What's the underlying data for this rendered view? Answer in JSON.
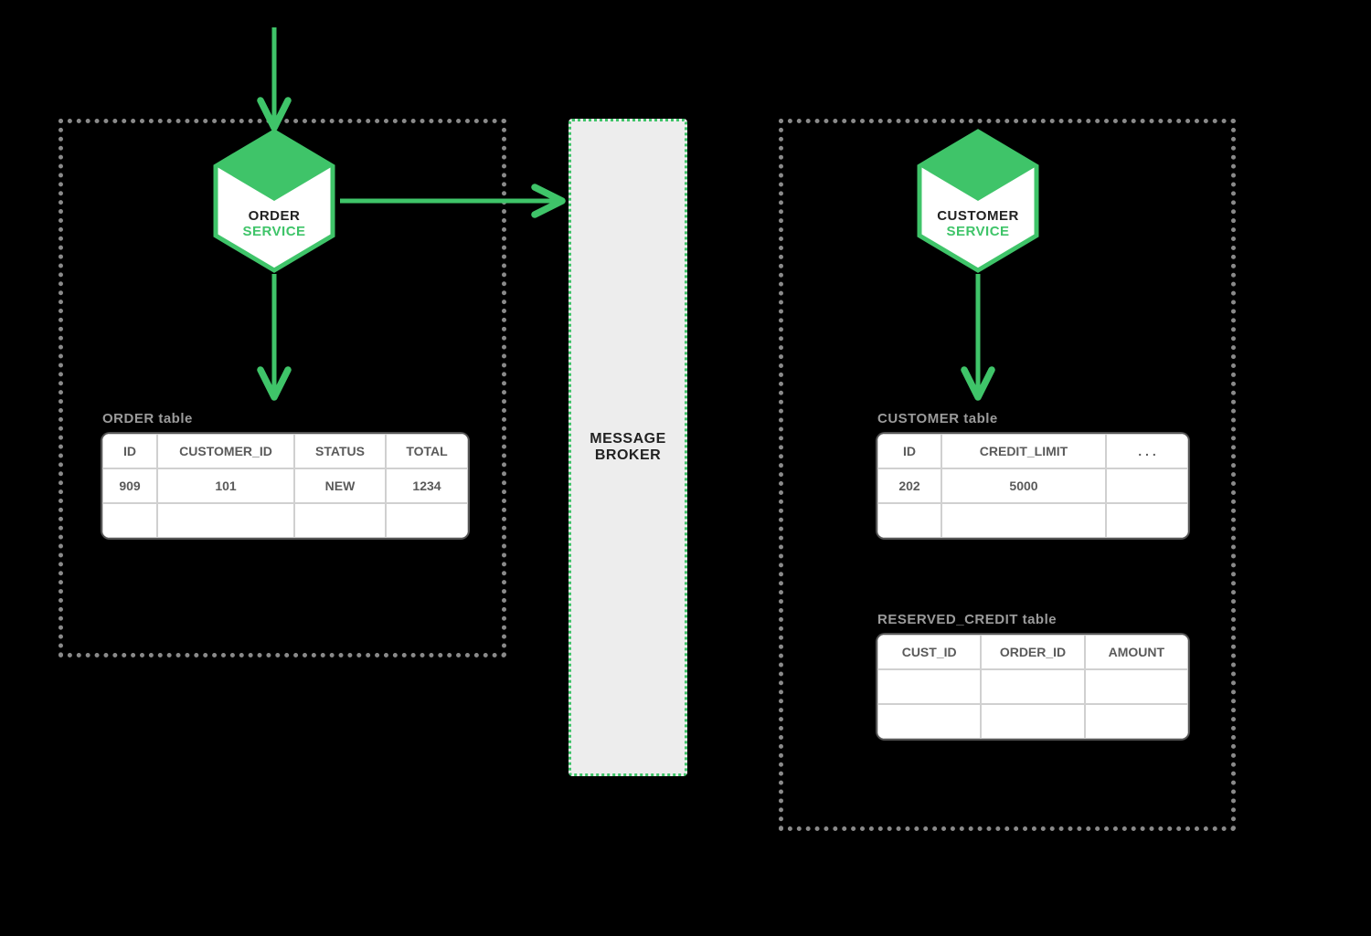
{
  "left_service": {
    "title_line1": "ORDER",
    "title_line2": "SERVICE"
  },
  "right_service": {
    "title_line1": "CUSTOMER",
    "title_line2": "SERVICE"
  },
  "broker": {
    "line1": "MESSAGE",
    "line2": "BROKER"
  },
  "order_table": {
    "title": "ORDER table",
    "headers": [
      "ID",
      "CUSTOMER_ID",
      "STATUS",
      "TOTAL"
    ],
    "rows": [
      [
        "909",
        "101",
        "NEW",
        "1234"
      ],
      [
        "",
        "",
        "",
        ""
      ]
    ]
  },
  "customer_table": {
    "title": "CUSTOMER table",
    "headers": [
      "ID",
      "CREDIT_LIMIT",
      ". . ."
    ],
    "rows": [
      [
        "202",
        "5000",
        ""
      ],
      [
        "",
        "",
        ""
      ]
    ]
  },
  "reserved_table": {
    "title": "RESERVED_CREDIT table",
    "headers": [
      "CUST_ID",
      "ORDER_ID",
      "AMOUNT"
    ],
    "rows": [
      [
        "",
        "",
        ""
      ],
      [
        "",
        "",
        ""
      ]
    ]
  },
  "colors": {
    "accent": "#3fc469",
    "border": "#8a8a8a"
  }
}
